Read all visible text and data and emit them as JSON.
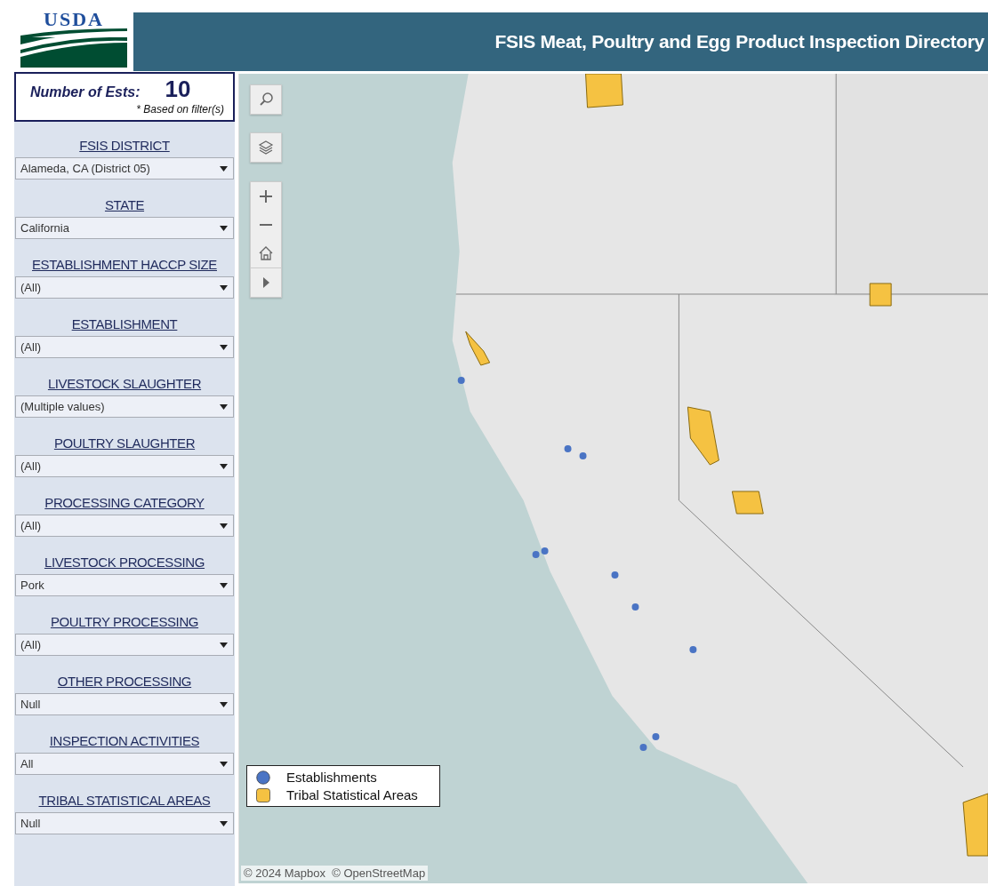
{
  "header": {
    "logo_text": "USDA",
    "title": "FSIS Meat, Poultry and Egg Product Inspection Directory"
  },
  "count": {
    "label": "Number of Ests:",
    "value": "10",
    "note": "* Based on filter(s)"
  },
  "filters": [
    {
      "label": "FSIS DISTRICT",
      "value": "Alameda, CA (District 05)"
    },
    {
      "label": "STATE",
      "value": "California"
    },
    {
      "label": "ESTABLISHMENT HACCP SIZE",
      "value": "(All)"
    },
    {
      "label": "ESTABLISHMENT",
      "value": "(All)"
    },
    {
      "label": "LIVESTOCK SLAUGHTER",
      "value": "(Multiple values)"
    },
    {
      "label": "POULTRY SLAUGHTER",
      "value": "(All)"
    },
    {
      "label": "PROCESSING CATEGORY",
      "value": "(All)"
    },
    {
      "label": "LIVESTOCK PROCESSING",
      "value": "Pork"
    },
    {
      "label": "POULTRY PROCESSING",
      "value": "(All)"
    },
    {
      "label": "OTHER PROCESSING",
      "value": "Null"
    },
    {
      "label": "INSPECTION ACTIVITIES",
      "value": "All"
    },
    {
      "label": "TRIBAL STATISTICAL AREAS",
      "value": "Null"
    }
  ],
  "map": {
    "kind": "picture",
    "legend": [
      {
        "kind": "circle",
        "label": "Establishments",
        "color": "#4a74c4"
      },
      {
        "kind": "square",
        "label": "Tribal Statistical Areas",
        "color": "#f5c242"
      }
    ],
    "attribution": "© 2024 Mapbox  © OpenStreetMap"
  }
}
